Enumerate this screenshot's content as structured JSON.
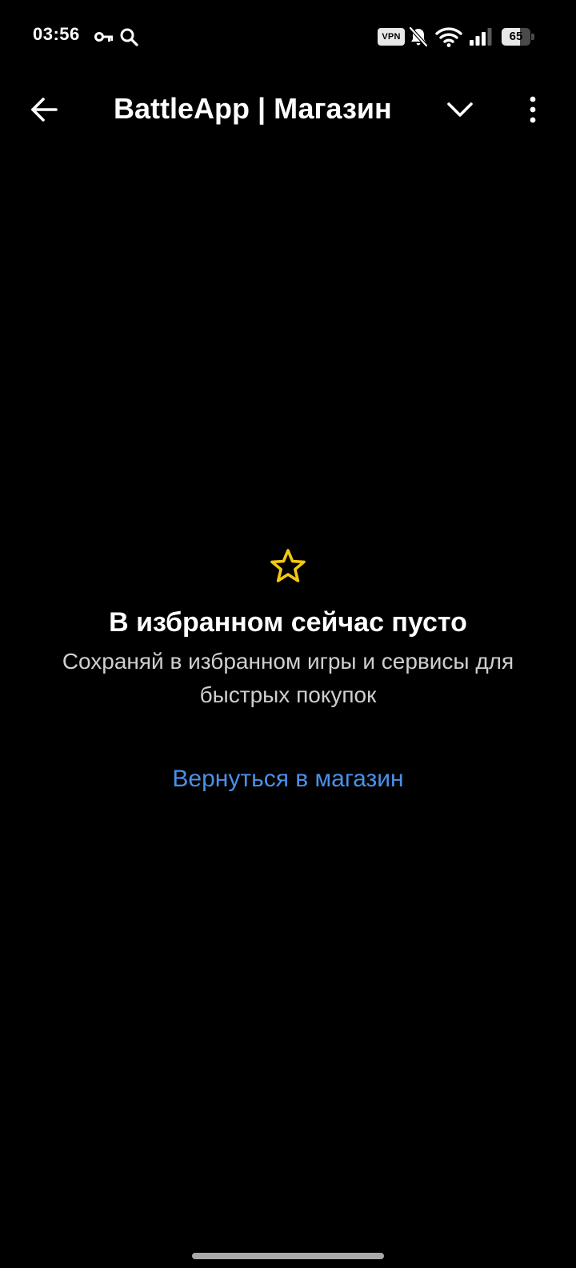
{
  "status_bar": {
    "time": "03:56",
    "vpn_label": "VPN",
    "battery_level": "65",
    "battery_fraction": 0.65,
    "icons": [
      "key-icon",
      "search-icon",
      "vpn-icon",
      "notifications-muted-icon",
      "wifi-icon",
      "signal-icon",
      "battery-icon"
    ]
  },
  "app_bar": {
    "title": "BattleApp | Магазин",
    "icons": [
      "arrow-back-icon",
      "chevron-down-icon",
      "more-vert-icon"
    ]
  },
  "empty_state": {
    "icon": "star-outline-icon",
    "title": "В избранном сейчас пусто",
    "subtitle": "Сохраняй в избранном игры и сервисы для быстрых покупок",
    "link_label": "Вернуться в магазин"
  },
  "colors": {
    "background": "#000000",
    "text_primary": "#ffffff",
    "text_secondary": "#cfcfcf",
    "link": "#4a90e8",
    "star": "#f2c811"
  }
}
